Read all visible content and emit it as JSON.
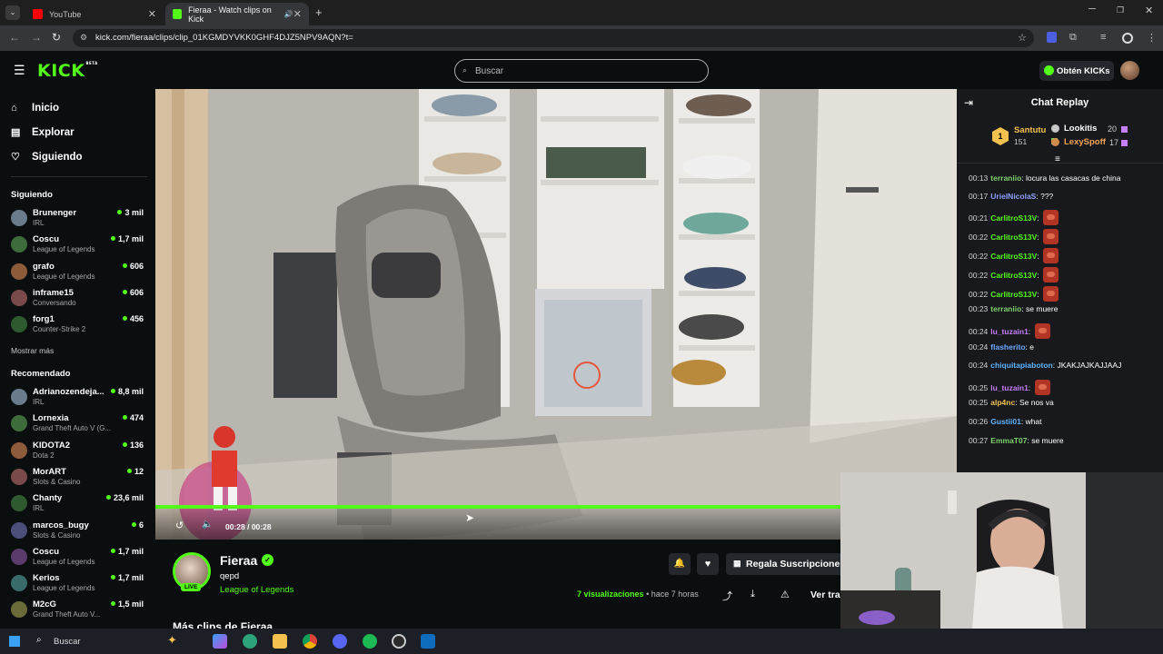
{
  "browser": {
    "tabs": [
      {
        "title": "YouTube",
        "favicon": "youtube-icon"
      },
      {
        "title": "Fieraa - Watch clips on Kick",
        "favicon": "kick-icon"
      }
    ],
    "url": "kick.com/fieraa/clips/clip_01KGMDYVKK0GHF4DJZ5NPV9AQN?t="
  },
  "header": {
    "logo": "KICK",
    "logo_badge": "BETA",
    "search_placeholder": "Buscar",
    "kicks_button": "Obtén KICKs"
  },
  "sidebar": {
    "nav": [
      {
        "label": "Inicio",
        "icon": "home-icon"
      },
      {
        "label": "Explorar",
        "icon": "compass-icon"
      },
      {
        "label": "Siguiendo",
        "icon": "heart-icon"
      }
    ],
    "following_title": "Siguiendo",
    "following": [
      {
        "name": "Brunenger",
        "category": "IRL",
        "viewers": "3 mil"
      },
      {
        "name": "Coscu",
        "category": "League of Legends",
        "viewers": "1,7 mil"
      },
      {
        "name": "grafo",
        "category": "League of Legends",
        "viewers": "606"
      },
      {
        "name": "inframe15",
        "category": "Conversando",
        "viewers": "606"
      },
      {
        "name": "forg1",
        "category": "Counter-Strike 2",
        "viewers": "456"
      }
    ],
    "show_more": "Mostrar más",
    "recommended_title": "Recomendado",
    "recommended": [
      {
        "name": "Adrianozendeja...",
        "category": "IRL",
        "viewers": "8,8 mil"
      },
      {
        "name": "Lornexia",
        "category": "Grand Theft Auto V (G...",
        "viewers": "474"
      },
      {
        "name": "KIDOTA2",
        "category": "Dota 2",
        "viewers": "136"
      },
      {
        "name": "MorART",
        "category": "Slots & Casino",
        "viewers": "12"
      },
      {
        "name": "Chanty",
        "category": "IRL",
        "viewers": "23,6 mil"
      },
      {
        "name": "marcos_bugy",
        "category": "Slots & Casino",
        "viewers": "6"
      },
      {
        "name": "Coscu",
        "category": "League of Legends",
        "viewers": "1,7 mil"
      },
      {
        "name": "Kerios",
        "category": "League of Legends",
        "viewers": "1,7 mil"
      },
      {
        "name": "M2cG",
        "category": "Grand Theft Auto V...",
        "viewers": "1,5 mil"
      }
    ]
  },
  "player": {
    "time": "00:28 / 00:28",
    "progress_fraction": 1.0
  },
  "channel": {
    "name": "Fieraa",
    "clip_title": "qepd",
    "category": "League of Legends",
    "live_badge": "LIVE",
    "gift_button": "Regala Suscripcione",
    "views": "7 visualizaciones",
    "age": "• hace 7 horas",
    "watch_full": "Ver tra",
    "more_clips": "Más clips de Fieraa"
  },
  "chat": {
    "title": "Chat Replay",
    "leaderboard": [
      {
        "rank": "1",
        "name": "Santutu",
        "count": "151"
      },
      {
        "name": "Lookitis",
        "count": "20"
      },
      {
        "name": "LexySpoff",
        "count": "17"
      }
    ],
    "messages": [
      {
        "time": "00:13",
        "user": "terraniio",
        "color": "#7fd16b",
        "text": "locura las casacas de china",
        "emote": false
      },
      {
        "time": "00:17",
        "user": "UrielNicolaS",
        "color": "#8ea0ff",
        "text": "???",
        "emote": false
      },
      {
        "time": "00:21",
        "user": "CarlitroS13V",
        "color": "#53fc18",
        "text": "",
        "emote": true
      },
      {
        "time": "00:22",
        "user": "CarlitroS13V",
        "color": "#53fc18",
        "text": "",
        "emote": true
      },
      {
        "time": "00:22",
        "user": "CarlitroS13V",
        "color": "#53fc18",
        "text": "",
        "emote": true
      },
      {
        "time": "00:22",
        "user": "CarlitroS13V",
        "color": "#53fc18",
        "text": "",
        "emote": true
      },
      {
        "time": "00:22",
        "user": "CarlitroS13V",
        "color": "#53fc18",
        "text": "",
        "emote": true
      },
      {
        "time": "00:23",
        "user": "terraniio",
        "color": "#7fd16b",
        "text": "se muere",
        "emote": false
      },
      {
        "time": "00:24",
        "user": "lu_tuzain1",
        "color": "#c77dff",
        "text": "",
        "emote": true
      },
      {
        "time": "00:24",
        "user": "flasherito",
        "color": "#6aa8ff",
        "text": "e",
        "emote": false
      },
      {
        "time": "00:24",
        "user": "chiquitapiaboton",
        "color": "#5fb4ff",
        "text": "JKAKJAJKAJJAAJ",
        "emote": false
      },
      {
        "time": "00:25",
        "user": "lu_tuzain1",
        "color": "#c77dff",
        "text": "",
        "emote": true
      },
      {
        "time": "00:25",
        "user": "alp4nc",
        "color": "#f2c14e",
        "text": "Se nos va",
        "emote": false
      },
      {
        "time": "00:26",
        "user": "Gustii01",
        "color": "#5fb4ff",
        "text": "what",
        "emote": false
      },
      {
        "time": "00:27",
        "user": "EmmaT07",
        "color": "#7fd16b",
        "text": "se muere",
        "emote": false
      }
    ]
  },
  "taskbar": {
    "search_label": "Buscar"
  },
  "colors": {
    "brand": "#53fc18",
    "page_bg": "#0b0e0f",
    "chat_bg": "#18191c"
  }
}
